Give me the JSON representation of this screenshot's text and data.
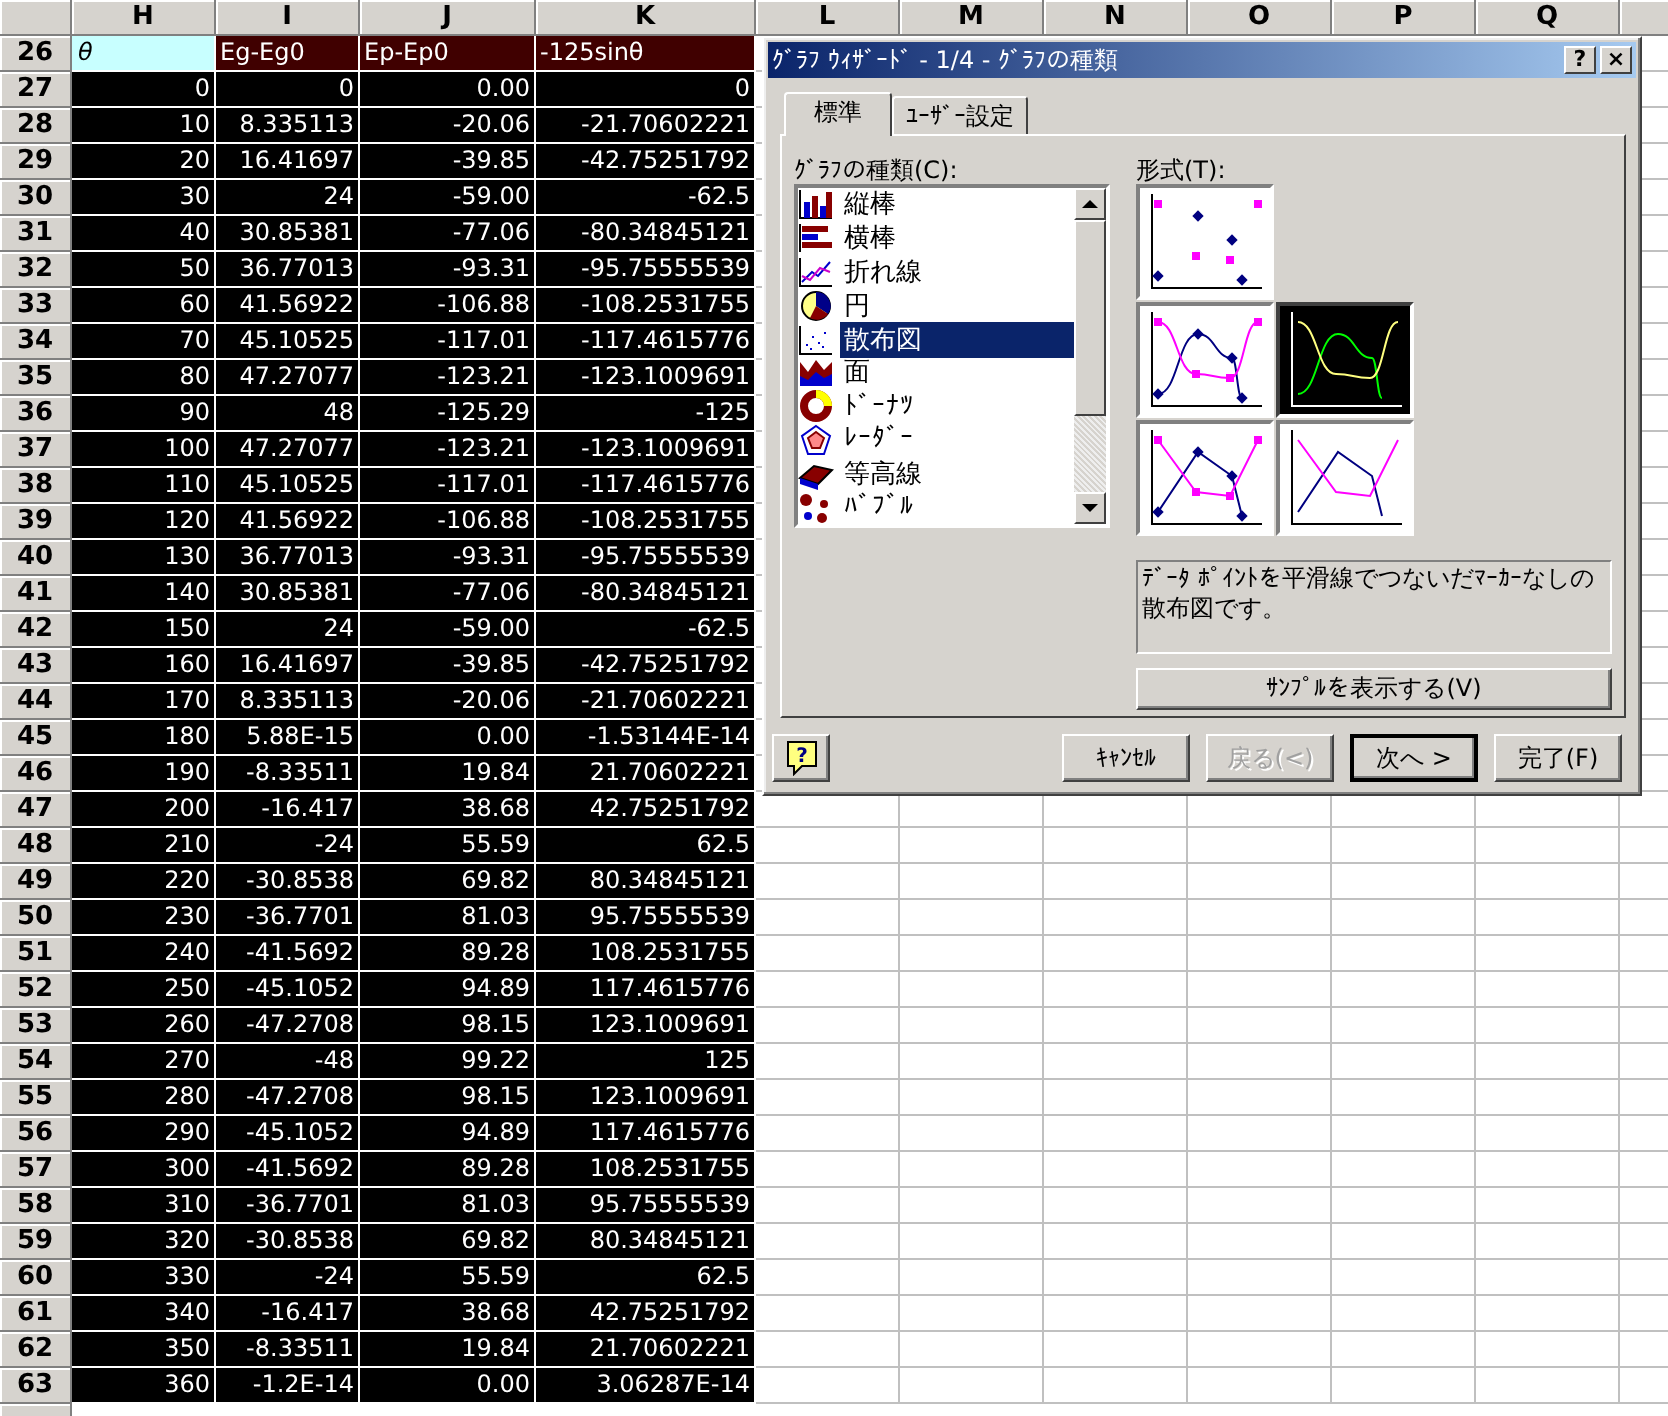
{
  "sheet": {
    "columns": [
      "H",
      "I",
      "J",
      "K",
      "L",
      "M",
      "N",
      "O",
      "P",
      "Q"
    ],
    "header_row": {
      "number": "26",
      "cells": [
        {
          "text": "θ",
          "active": true
        },
        {
          "text": "Eg-Eg0",
          "active": false
        },
        {
          "text": "Ep-Ep0",
          "active": false
        },
        {
          "text": "-125sinθ",
          "active": false
        }
      ]
    },
    "rows": [
      {
        "number": "27",
        "selected": true,
        "cells": [
          "0",
          "0",
          "0.00",
          "0"
        ]
      },
      {
        "number": "28",
        "selected": true,
        "cells": [
          "10",
          "8.335113",
          "-20.06",
          "-21.70602221"
        ]
      },
      {
        "number": "29",
        "selected": true,
        "cells": [
          "20",
          "16.41697",
          "-39.85",
          "-42.75251792"
        ]
      },
      {
        "number": "30",
        "selected": true,
        "cells": [
          "30",
          "24",
          "-59.00",
          "-62.5"
        ]
      },
      {
        "number": "31",
        "selected": true,
        "cells": [
          "40",
          "30.85381",
          "-77.06",
          "-80.34845121"
        ]
      },
      {
        "number": "32",
        "selected": true,
        "cells": [
          "50",
          "36.77013",
          "-93.31",
          "-95.75555539"
        ]
      },
      {
        "number": "33",
        "selected": true,
        "cells": [
          "60",
          "41.56922",
          "-106.88",
          "-108.2531755"
        ]
      },
      {
        "number": "34",
        "selected": true,
        "cells": [
          "70",
          "45.10525",
          "-117.01",
          "-117.4615776"
        ]
      },
      {
        "number": "35",
        "selected": true,
        "cells": [
          "80",
          "47.27077",
          "-123.21",
          "-123.1009691"
        ]
      },
      {
        "number": "36",
        "selected": true,
        "cells": [
          "90",
          "48",
          "-125.29",
          "-125"
        ]
      },
      {
        "number": "37",
        "selected": true,
        "cells": [
          "100",
          "47.27077",
          "-123.21",
          "-123.1009691"
        ]
      },
      {
        "number": "38",
        "selected": true,
        "cells": [
          "110",
          "45.10525",
          "-117.01",
          "-117.4615776"
        ]
      },
      {
        "number": "39",
        "selected": true,
        "cells": [
          "120",
          "41.56922",
          "-106.88",
          "-108.2531755"
        ]
      },
      {
        "number": "40",
        "selected": true,
        "cells": [
          "130",
          "36.77013",
          "-93.31",
          "-95.75555539"
        ]
      },
      {
        "number": "41",
        "selected": true,
        "cells": [
          "140",
          "30.85381",
          "-77.06",
          "-80.34845121"
        ]
      },
      {
        "number": "42",
        "selected": true,
        "cells": [
          "150",
          "24",
          "-59.00",
          "-62.5"
        ]
      },
      {
        "number": "43",
        "selected": true,
        "cells": [
          "160",
          "16.41697",
          "-39.85",
          "-42.75251792"
        ]
      },
      {
        "number": "44",
        "selected": true,
        "cells": [
          "170",
          "8.335113",
          "-20.06",
          "-21.70602221"
        ]
      },
      {
        "number": "45",
        "selected": true,
        "cells": [
          "180",
          "5.88E-15",
          "0.00",
          "-1.53144E-14"
        ]
      },
      {
        "number": "46",
        "selected": true,
        "cells": [
          "190",
          "-8.33511",
          "19.84",
          "21.70602221"
        ]
      },
      {
        "number": "47",
        "selected": true,
        "cells": [
          "200",
          "-16.417",
          "38.68",
          "42.75251792"
        ]
      },
      {
        "number": "48",
        "selected": true,
        "cells": [
          "210",
          "-24",
          "55.59",
          "62.5"
        ]
      },
      {
        "number": "49",
        "selected": true,
        "cells": [
          "220",
          "-30.8538",
          "69.82",
          "80.34845121"
        ]
      },
      {
        "number": "50",
        "selected": true,
        "cells": [
          "230",
          "-36.7701",
          "81.03",
          "95.75555539"
        ]
      },
      {
        "number": "51",
        "selected": true,
        "cells": [
          "240",
          "-41.5692",
          "89.28",
          "108.2531755"
        ]
      },
      {
        "number": "52",
        "selected": true,
        "cells": [
          "250",
          "-45.1052",
          "94.89",
          "117.4615776"
        ]
      },
      {
        "number": "53",
        "selected": true,
        "cells": [
          "260",
          "-47.2708",
          "98.15",
          "123.1009691"
        ]
      },
      {
        "number": "54",
        "selected": true,
        "cells": [
          "270",
          "-48",
          "99.22",
          "125"
        ]
      },
      {
        "number": "55",
        "selected": true,
        "cells": [
          "280",
          "-47.2708",
          "98.15",
          "123.1009691"
        ]
      },
      {
        "number": "56",
        "selected": true,
        "cells": [
          "290",
          "-45.1052",
          "94.89",
          "117.4615776"
        ]
      },
      {
        "number": "57",
        "selected": true,
        "cells": [
          "300",
          "-41.5692",
          "89.28",
          "108.2531755"
        ]
      },
      {
        "number": "58",
        "selected": true,
        "cells": [
          "310",
          "-36.7701",
          "81.03",
          "95.75555539"
        ]
      },
      {
        "number": "59",
        "selected": true,
        "cells": [
          "320",
          "-30.8538",
          "69.82",
          "80.34845121"
        ]
      },
      {
        "number": "60",
        "selected": true,
        "cells": [
          "330",
          "-24",
          "55.59",
          "62.5"
        ]
      },
      {
        "number": "61",
        "selected": true,
        "cells": [
          "340",
          "-16.417",
          "38.68",
          "42.75251792"
        ]
      },
      {
        "number": "62",
        "selected": true,
        "cells": [
          "350",
          "-8.33511",
          "19.84",
          "21.70602221"
        ]
      },
      {
        "number": "63",
        "selected": true,
        "cells": [
          "360",
          "-1.2E-14",
          "0.00",
          "3.06287E-14"
        ]
      }
    ]
  },
  "dialog": {
    "title": "ｸﾞﾗﾌ ｳｨｻﾞｰﾄﾞ - 1/4 - ｸﾞﾗﾌの種類",
    "title_buttons": [
      "?",
      "×"
    ],
    "tabs": [
      {
        "label": "標準",
        "selected": true
      },
      {
        "label": "ﾕｰｻﾞｰ設定",
        "selected": false
      }
    ],
    "chart_type_label": "ｸﾞﾗﾌの種類(C):",
    "chart_types": [
      {
        "kind": "column",
        "label": "縦棒",
        "selected": false
      },
      {
        "kind": "bar",
        "label": "横棒",
        "selected": false
      },
      {
        "kind": "line",
        "label": "折れ線",
        "selected": false
      },
      {
        "kind": "pie",
        "label": "円",
        "selected": false
      },
      {
        "kind": "scatter",
        "label": "散布図",
        "selected": true
      },
      {
        "kind": "area",
        "label": "面",
        "selected": false
      },
      {
        "kind": "doughnut",
        "label": "ﾄﾞｰﾅﾂ",
        "selected": false
      },
      {
        "kind": "radar",
        "label": "ﾚｰﾀﾞｰ",
        "selected": false
      },
      {
        "kind": "surface",
        "label": "等高線",
        "selected": false
      },
      {
        "kind": "bubble",
        "label": "ﾊﾞﾌﾞﾙ",
        "selected": false
      }
    ],
    "subtype_label": "形式(T):",
    "subtypes": [
      {
        "kind": "markers",
        "selected": false
      },
      {
        "kind": "smooth-markers",
        "selected": false
      },
      {
        "kind": "smooth",
        "selected": true
      },
      {
        "kind": "line-markers",
        "selected": false
      },
      {
        "kind": "line",
        "selected": false
      }
    ],
    "description": "ﾃﾞｰﾀ ﾎﾟｲﾝﾄを平滑線でつないだﾏｰｶｰなしの散布図です。",
    "sample_button": "ｻﾝﾌﾟﾙを表示する(V)",
    "buttons": [
      {
        "kind": "help",
        "label": "?",
        "disabled": false,
        "default": false
      },
      {
        "kind": "cancel",
        "label": "ｷｬﾝｾﾙ",
        "disabled": false,
        "default": false
      },
      {
        "kind": "back",
        "label": "戻る(<)",
        "disabled": true,
        "default": false
      },
      {
        "kind": "next",
        "label": "次へ >",
        "disabled": false,
        "default": true
      },
      {
        "kind": "finish",
        "label": "完了(F)",
        "disabled": false,
        "default": false
      }
    ]
  }
}
